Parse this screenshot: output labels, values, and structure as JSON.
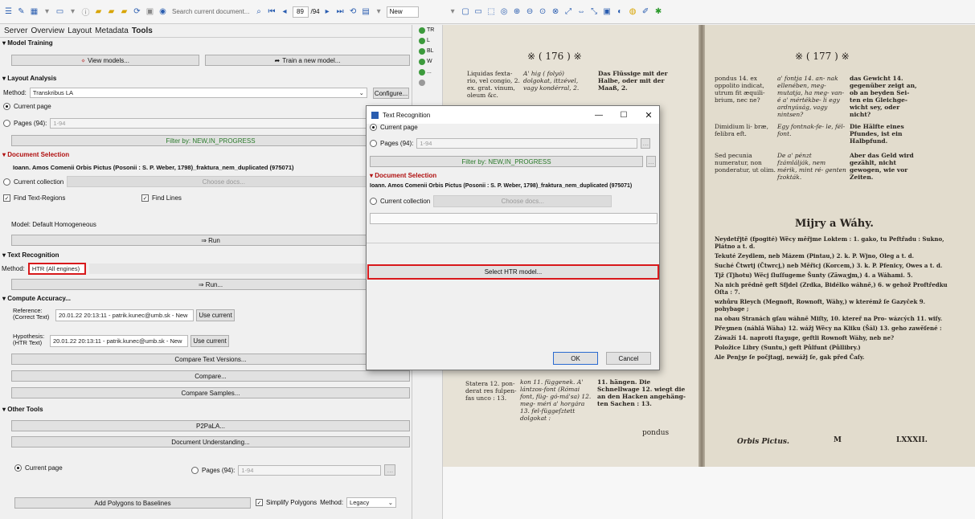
{
  "toolbar": {
    "search_placeholder": "Search current document...",
    "page_current": "89",
    "page_total": "/94",
    "new_label": "New"
  },
  "tabs": [
    "Server",
    "Overview",
    "Layout",
    "Metadata",
    "Tools"
  ],
  "model_training": {
    "title": "Model Training",
    "view_models": "View models...",
    "train_model": "Train a new model..."
  },
  "layout_analysis": {
    "title": "Layout Analysis",
    "method_label": "Method:",
    "method_value": "Transkribus LA",
    "configure": "Configure...",
    "current_page": "Current page",
    "pages_label": "Pages (94):",
    "pages_value": "1-94",
    "filter": "Filter by: NEW,IN_PROGRESS",
    "doc_selection_title": "Document Selection",
    "doc_name": "Ioann. Amos Comenii Orbis Pictus (Posonii : S. P. Weber, 1798)_fraktura_nem_duplicated (975071)",
    "current_collection": "Current collection",
    "choose_docs": "Choose docs...",
    "find_regions": "Find Text-Regions",
    "find_lines": "Find Lines",
    "model_label": "Model: Default Homogeneous",
    "run": "⇒ Run"
  },
  "text_recognition": {
    "title": "Text Recognition",
    "method_label": "Method:",
    "method_value": "HTR (All engines)",
    "run": "⇒ Run..."
  },
  "compute_accuracy": {
    "title": "Compute Accuracy...",
    "reference_label": "Reference:",
    "reference_sub": "(Correct Text)",
    "reference_value": "20.01.22 20:13:11 - patrik.kunec@umb.sk - New",
    "hypothesis_label": "Hypothesis:",
    "hypothesis_sub": "(HTR Text)",
    "hypothesis_value": "20.01.22 20:13:11 - patrik.kunec@umb.sk - New",
    "use_current": "Use current",
    "compare_versions": "Compare Text Versions...",
    "compare": "Compare...",
    "compare_samples": "Compare Samples..."
  },
  "other_tools": {
    "title": "Other Tools",
    "p2pala": "P2PaLA...",
    "doc_understanding": "Document Understanding...",
    "current_page": "Current page",
    "pages_label": "Pages (94):",
    "pages_value": "1-94",
    "add_polygons": "Add Polygons to Baselines",
    "simplify": "Simplify Polygons",
    "method_label": "Method:",
    "method_value": "Legacy"
  },
  "side_list": [
    "TR",
    "L",
    "BL",
    "W",
    "..."
  ],
  "dialog": {
    "title": "Text Recognition",
    "current_page": "Current page",
    "pages_label": "Pages (94):",
    "pages_value": "1-94",
    "filter": "Filter by: NEW,IN_PROGRESS",
    "doc_selection_title": "Document Selection",
    "doc_name": "Ioann. Amos Comenii Orbis Pictus (Posonii : S. P. Weber, 1798)_fraktura_nem_duplicated (975071)",
    "current_collection": "Current collection",
    "choose_docs": "Choose docs...",
    "select_model": "Select HTR model...",
    "ok": "OK",
    "cancel": "Cancel"
  },
  "page_left": {
    "header": "※ ( 176 ) ※",
    "col1": "Liquidas fexta- rio, vel congio, 2. ex. grat. vinum, oleum &c.",
    "col2": "A' hig ( folyó) dolgokat, ittzével, vagy kondérral, 2.",
    "col3": "Das Flüssige mit der Halbe, oder mit der Maaß, 2.",
    "bottom1": "Statera 12. pon- derat res fulpen- fas unco : 13.",
    "bottom2": "kon 11. függenek. A' lántzos-font (Római font, füg- gó-má'sa) 12. meg- méri a' horgára 13. fel-függeſztett dolgokat :",
    "bottom3": "11. hängen. Die Schnellwage 12. wiegt die an den Hacken angehäng- ten Sachen : 13.",
    "footer": "pondus"
  },
  "page_right": {
    "header": "※ ( 177 ) ※",
    "col1": "pondus 14. ex oppolito indicat, utrum fit æquili- brium, nec ne?",
    "col2": "a' fontja 14. an- nak ellenében, meg- mutatja, ha meg- van-é a' mértékbe- li egy ardnyúság, vagy nintsen?",
    "col3": "das Gewicht 14. gegenüber zeigt an, ob an beyden Sei- ten ein Gleichge- wicht sey, oder nicht?",
    "row2a": "Dimidium li- bræ, felibra eft.",
    "row2b": "Egy fontnak-fe- le, fél-font.",
    "row2c": "Die Hälfte eines Pfundes, ist ein Halbpfund.",
    "row3a": "Sed pecunia numeratur, non ponderatur, ut olim.",
    "row3b": "De a' pénzt fzámlálják, nem mérik, mint ré- genten fzokták.",
    "row3c": "Aber das Geld wird gezählt, nicht gewogen, wie vor Zeiten.",
    "title": "Mijry a Wáhy.",
    "lines": [
      "Neydetřjtě (fpogité) Wěcy měřjme Loktem : 1. gako, tu Peftřadu : Sukno, Plátno a t. d.",
      "Tekuté Zeydlem, neb Mázem (Pintau,) 2. k. P. Wjno, Oleg a t. d.",
      "Suché Čtwrtj (Čtwrcj,) neb Měřicj (Korcem,) 3. k. P. Pfenicy, Owes a t. d.",
      "Tjž (Tjhotu) Wěcj ſluſſugeme Šunty (Zäwaʒjm,) 4. a Wáhami. 5.",
      "Na nich prědně geft Sfjdel (Zrdka, Bidélko wáhně,) 6. w gehož Proftředku Oſta : 7.",
      "wzhůru Rleych (Megnoft, Rownoft, Wáhy,) w kterémž ſe Gazyček 9. pohybage ;",
      "na obau Stranách gſau wáhně Miſty, 10. ktereř na Pro- wázcých 11. wiſy.",
      "Přeʒmen (náhlá Wáha) 12. wážj Wěcy na Kliku (Šál) 13. geho zawěſené :",
      "Záwaží 14. naproti ſtaʒuge, geftli Rownoft Wáhy, neb ne?",
      "Položice Libry (Suntu,) geft Půlfunt (Půllibry.)",
      "Ale Penjʒe ſe počjtagj, newážj ſe, gak před Čaſy."
    ],
    "footer_left": "Orbis Pictus.",
    "footer_mid": "M",
    "footer_right": "LXXXII."
  }
}
